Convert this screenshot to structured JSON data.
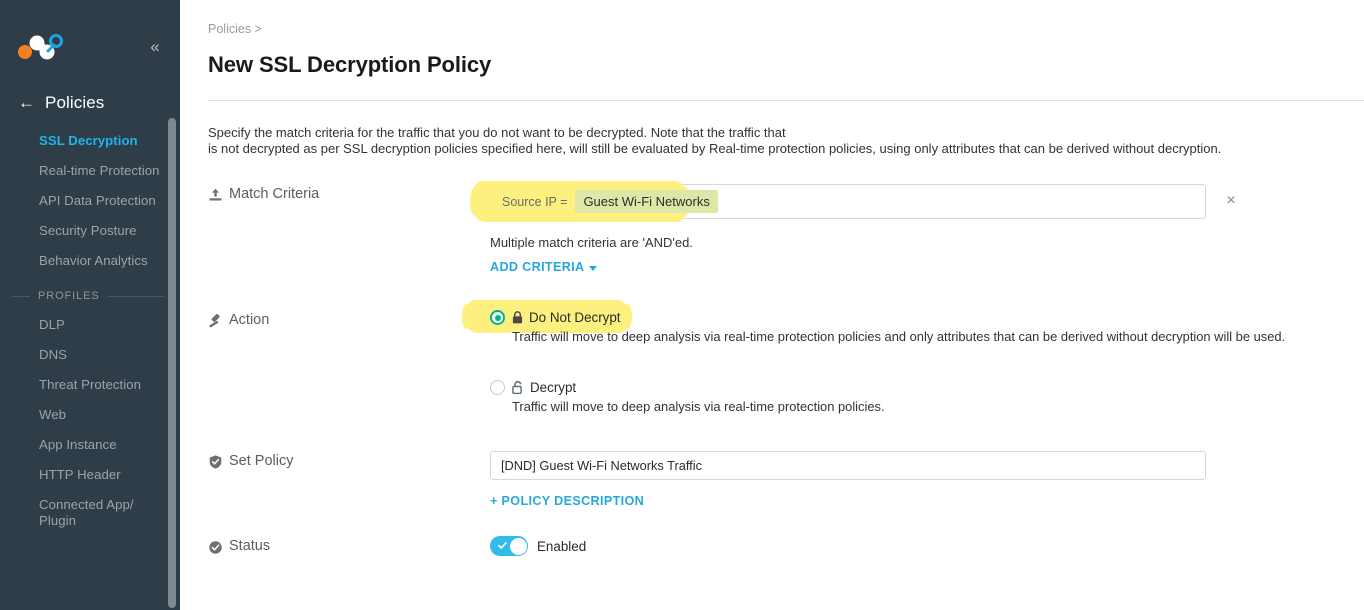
{
  "sidebar": {
    "logo_name": "netskope-logo",
    "collapse_label": "«",
    "back_arrow": "←",
    "back_title": "Policies",
    "items": [
      {
        "label": "SSL Decryption",
        "active": true
      },
      {
        "label": "Real-time Protection",
        "active": false
      },
      {
        "label": "API Data Protection",
        "active": false
      },
      {
        "label": "Security Posture",
        "active": false
      },
      {
        "label": "Behavior Analytics",
        "active": false
      }
    ],
    "section_label": "PROFILES",
    "profile_items": [
      {
        "label": "DLP"
      },
      {
        "label": "DNS"
      },
      {
        "label": "Threat Protection"
      },
      {
        "label": "Web"
      },
      {
        "label": "App Instance"
      },
      {
        "label": "HTTP Header"
      },
      {
        "label": "Connected App/ Plugin"
      }
    ],
    "accent_active": "#1eb4e8",
    "background": "#2f3d49"
  },
  "header": {
    "breadcrumb": "Policies >",
    "title": "New SSL Decryption Policy"
  },
  "intro": {
    "line1": "Specify the match criteria for the traffic that you do not want to be decrypted. Note that the traffic that",
    "line2": "is not decrypted as per SSL decryption policies specified here, will still be evaluated by Real-time protection policies, using only attributes that can be derived without decryption."
  },
  "match_criteria": {
    "label": "Match Criteria",
    "icon": "upload-icon",
    "chip_key": "Source IP =",
    "chip_value": "Guest Wi-Fi Networks",
    "remove_icon": "×",
    "hint": "Multiple match criteria are 'AND'ed.",
    "add_link": "ADD CRITERIA",
    "highlight_color": "#fdf07e",
    "chip_color": "#dbe8a7"
  },
  "action": {
    "label": "Action",
    "icon": "gavel-icon",
    "options": [
      {
        "label": "Do Not Decrypt",
        "icon": "lock-closed-icon",
        "selected": true,
        "description": "Traffic will move to deep analysis via real-time protection policies and only attributes that can be derived without decryption will be used.",
        "highlighted": true
      },
      {
        "label": "Decrypt",
        "icon": "lock-open-icon",
        "selected": false,
        "description": "Traffic will move to deep analysis via real-time protection policies.",
        "highlighted": false
      }
    ],
    "radio_color": "#00b289"
  },
  "set_policy": {
    "label": "Set Policy",
    "icon": "shield-check-icon",
    "value": "[DND] Guest Wi-Fi Networks Traffic",
    "placeholder": "",
    "description_link": "+ POLICY DESCRIPTION"
  },
  "status": {
    "label": "Status",
    "icon": "circle-check-icon",
    "toggle_label": "Enabled",
    "enabled": true,
    "toggle_color": "#33bbec"
  }
}
